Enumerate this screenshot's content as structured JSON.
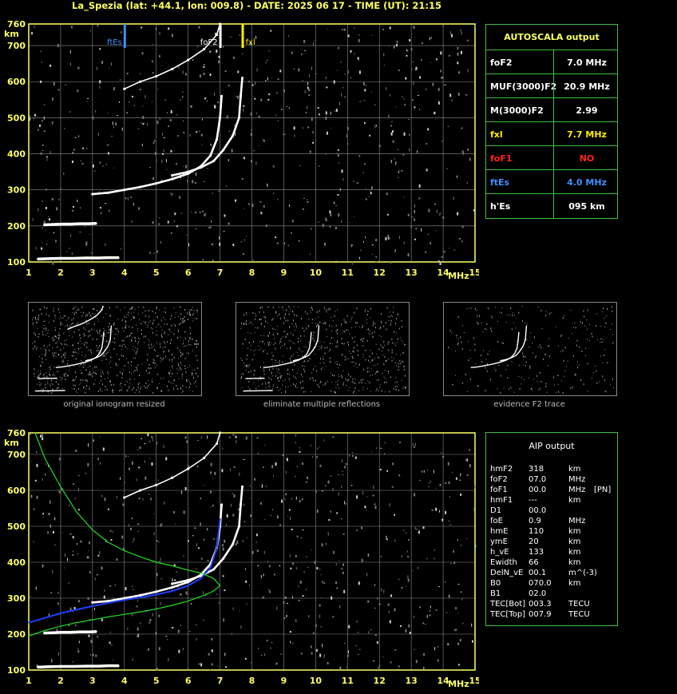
{
  "header": "La_Spezia (lat: +44.1, lon: 009.8) - DATE: 2025 06 17 - TIME (UT): 21:15",
  "colors": {
    "grid": "#bbbbbb",
    "axis": "#ffff66",
    "border": "#3fbf3f",
    "ftes": "#3f8fff",
    "fxl": "#ffee00",
    "profile": "#22dd22",
    "trace_fit": "#1f3fff"
  },
  "chart_data": [
    {
      "id": "top-ionogram",
      "type": "scatter",
      "xlabel": "MHz",
      "ylabel": "km",
      "xlim": [
        1,
        15
      ],
      "ylim": [
        100,
        760
      ],
      "xticks": [
        1,
        2,
        3,
        4,
        5,
        6,
        7,
        8,
        9,
        10,
        11,
        12,
        13,
        14,
        15
      ],
      "yticks": [
        100,
        200,
        300,
        400,
        500,
        600,
        700,
        760
      ],
      "markers": [
        {
          "label": "ftEs",
          "x": 4.0,
          "color": "#3f8fff"
        },
        {
          "label": "foF2",
          "x": 7.0,
          "color": "#ffffff"
        },
        {
          "label": "fxl",
          "x": 7.7,
          "color": "#ffee00"
        }
      ],
      "series": [
        {
          "x": [
            3.0,
            3.5,
            4.0,
            4.5,
            5.0,
            5.5,
            6.0,
            6.4,
            6.7,
            6.9,
            7.0,
            7.05
          ],
          "y": [
            288,
            292,
            300,
            308,
            318,
            330,
            345,
            365,
            395,
            440,
            500,
            560
          ]
        },
        {
          "x": [
            5.5,
            6.0,
            6.4,
            6.8,
            7.1,
            7.4,
            7.6,
            7.65,
            7.7
          ],
          "y": [
            340,
            350,
            362,
            380,
            410,
            450,
            500,
            560,
            610
          ]
        },
        {
          "x": [
            4.0,
            4.5,
            5.0,
            5.5,
            6.0,
            6.5,
            6.9,
            7.0
          ],
          "y": [
            580,
            600,
            615,
            635,
            660,
            690,
            730,
            760
          ]
        },
        {
          "x": [
            1.3,
            1.6,
            2.0,
            2.4,
            2.8,
            3.2,
            3.5,
            3.8
          ],
          "y": [
            108,
            109,
            110,
            110,
            111,
            111,
            112,
            112
          ]
        },
        {
          "x": [
            1.5,
            1.8,
            2.0,
            2.3,
            2.6,
            2.9,
            3.1
          ],
          "y": [
            203,
            204,
            205,
            205,
            206,
            206,
            207
          ]
        }
      ]
    },
    {
      "id": "bottom-ionogram",
      "type": "line",
      "xlabel": "MHz",
      "ylabel": "km",
      "xlim": [
        1,
        15
      ],
      "ylim": [
        100,
        760
      ],
      "xticks": [
        1,
        2,
        3,
        4,
        5,
        6,
        7,
        8,
        9,
        10,
        11,
        12,
        13,
        14,
        15
      ],
      "yticks": [
        100,
        200,
        300,
        400,
        500,
        600,
        700,
        760
      ],
      "series": [
        {
          "x": [
            3.0,
            3.5,
            4.0,
            4.5,
            5.0,
            5.5,
            6.0,
            6.4,
            6.7,
            6.9,
            7.0,
            7.05
          ],
          "y": [
            288,
            292,
            300,
            308,
            318,
            330,
            345,
            365,
            395,
            440,
            500,
            560
          ]
        },
        {
          "x": [
            5.5,
            6.0,
            6.4,
            6.8,
            7.1,
            7.4,
            7.6,
            7.65,
            7.7
          ],
          "y": [
            340,
            350,
            362,
            380,
            410,
            450,
            500,
            560,
            610
          ]
        },
        {
          "x": [
            4.0,
            4.5,
            5.0,
            5.5,
            6.0,
            6.5,
            6.9,
            7.0
          ],
          "y": [
            580,
            600,
            615,
            635,
            660,
            690,
            730,
            760
          ]
        },
        {
          "x": [
            1.3,
            1.6,
            2.0,
            2.4,
            2.8,
            3.2,
            3.5,
            3.8
          ],
          "y": [
            108,
            109,
            110,
            110,
            111,
            111,
            112,
            112
          ]
        },
        {
          "x": [
            1.5,
            1.8,
            2.0,
            2.3,
            2.6,
            2.9,
            3.1
          ],
          "y": [
            203,
            204,
            205,
            205,
            206,
            206,
            207
          ]
        },
        {
          "x": [
            1.0,
            1.5,
            2.0,
            2.5,
            3.0,
            3.5,
            4.0,
            4.5,
            5.0,
            5.5,
            6.0,
            6.4,
            6.7,
            6.9,
            7.0
          ],
          "y": [
            232,
            245,
            258,
            268,
            278,
            287,
            295,
            302,
            310,
            320,
            335,
            355,
            385,
            440,
            520
          ]
        },
        {
          "x": [
            1.0,
            1.5,
            2.0,
            2.5,
            3.0,
            3.5,
            4.0,
            4.5,
            5.0,
            5.5,
            6.0,
            6.5,
            6.8,
            7.0,
            6.8,
            6.4,
            6.0,
            5.5,
            5.0,
            4.5,
            4.0,
            3.5,
            3.0,
            2.5,
            2.0,
            1.5,
            1.2
          ],
          "y": [
            195,
            210,
            222,
            232,
            240,
            248,
            255,
            262,
            270,
            280,
            292,
            308,
            320,
            335,
            355,
            370,
            378,
            390,
            400,
            415,
            432,
            455,
            490,
            540,
            610,
            690,
            760
          ]
        }
      ]
    }
  ],
  "autoscala": {
    "title": "AUTOSCALA output",
    "rows": [
      {
        "key": "foF2",
        "value": "7.0 MHz",
        "kcolor": "#ffffff",
        "vcolor": "#ffffff"
      },
      {
        "key": "MUF(3000)F2",
        "value": "20.9 MHz",
        "kcolor": "#ffffff",
        "vcolor": "#ffffff"
      },
      {
        "key": "M(3000)F2",
        "value": "2.99",
        "kcolor": "#ffffff",
        "vcolor": "#ffffff"
      },
      {
        "key": "fxl",
        "value": "7.7 MHz",
        "kcolor": "#ffee00",
        "vcolor": "#ffee00"
      },
      {
        "key": "foF1",
        "value": "NO",
        "kcolor": "#ff2222",
        "vcolor": "#ff2222"
      },
      {
        "key": "ftEs",
        "value": "4.0 MHz",
        "kcolor": "#3f8fff",
        "vcolor": "#3f8fff"
      },
      {
        "key": "h'Es",
        "value": "095     km",
        "kcolor": "#ffffff",
        "vcolor": "#ffffff"
      }
    ]
  },
  "aip": {
    "title": "AIP output",
    "rows": [
      {
        "k": "hmF2",
        "v": "318",
        "u": "km",
        "e": ""
      },
      {
        "k": "foF2",
        "v": "07.0",
        "u": "MHz",
        "e": ""
      },
      {
        "k": "foF1",
        "v": "00.0",
        "u": "MHz",
        "e": "[PN]"
      },
      {
        "k": "hmF1",
        "v": "---",
        "u": "km",
        "e": ""
      },
      {
        "k": "D1",
        "v": "00.0",
        "u": "",
        "e": ""
      },
      {
        "k": "foE",
        "v": "0.9",
        "u": "MHz",
        "e": ""
      },
      {
        "k": "hmE",
        "v": "110",
        "u": "km",
        "e": ""
      },
      {
        "k": "ymE",
        "v": "20",
        "u": "km",
        "e": ""
      },
      {
        "k": "h_vE",
        "v": "133",
        "u": "km",
        "e": ""
      },
      {
        "k": "Ewidth",
        "v": "66",
        "u": "km",
        "e": ""
      },
      {
        "k": "DelN_vE",
        "v": "00.1",
        "u": "m^(-3)",
        "e": ""
      },
      {
        "k": "B0",
        "v": "070.0",
        "u": "km",
        "e": ""
      },
      {
        "k": "B1",
        "v": "02.0",
        "u": "",
        "e": ""
      },
      {
        "k": "TEC[Bot]",
        "v": "003.3",
        "u": "TECU",
        "e": ""
      },
      {
        "k": "TEC[Top]",
        "v": "007.9",
        "u": "TECU",
        "e": ""
      }
    ]
  },
  "thumbnails": [
    {
      "caption": "original ionogram resized"
    },
    {
      "caption": "eliminate multiple reflections"
    },
    {
      "caption": "evidence F2 trace"
    }
  ]
}
